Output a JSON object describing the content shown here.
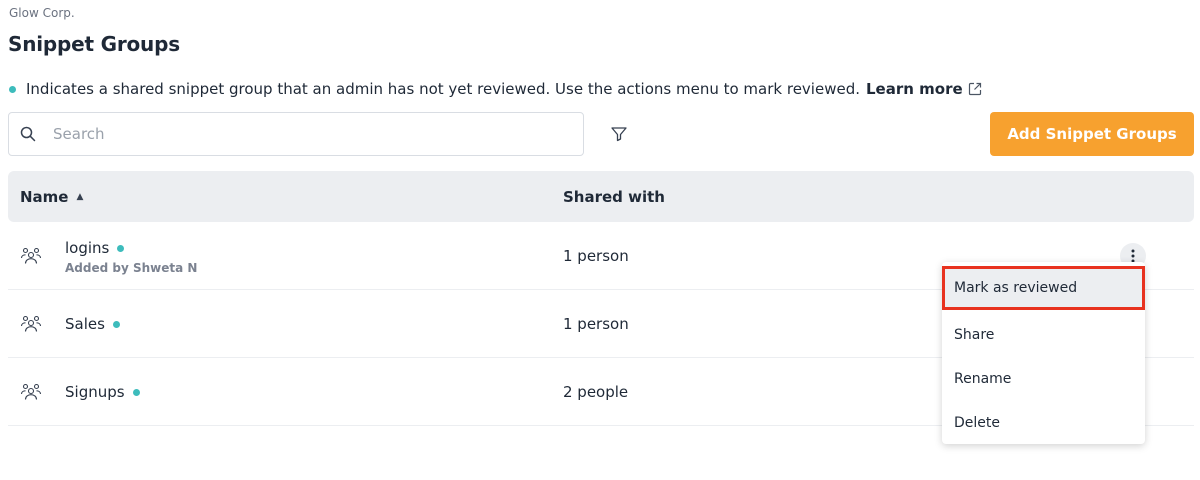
{
  "header": {
    "org_name": "Glow Corp.",
    "page_title": "Snippet Groups"
  },
  "notice": {
    "text": "Indicates a shared snippet group that an admin has not yet reviewed. Use the actions menu to mark reviewed.",
    "link_label": "Learn more",
    "dot_color": "#3dbcbc"
  },
  "search": {
    "placeholder": "Search",
    "value": ""
  },
  "toolbar": {
    "add_label": "Add Snippet Groups",
    "add_color": "#f7a12f"
  },
  "table": {
    "columns": {
      "name": "Name",
      "shared_with": "Shared with"
    },
    "sort": "ascending",
    "rows": [
      {
        "name": "logins",
        "added_by": "Added by Shweta N",
        "shared_with": "1 person",
        "unreviewed": true
      },
      {
        "name": "Sales",
        "added_by": "",
        "shared_with": "1 person",
        "unreviewed": true
      },
      {
        "name": "Signups",
        "added_by": "",
        "shared_with": "2 people",
        "unreviewed": true
      }
    ]
  },
  "actions_menu": {
    "items": [
      "Mark as reviewed",
      "Share",
      "Rename",
      "Delete"
    ],
    "highlighted": "Mark as reviewed",
    "highlight_color": "#e8321f"
  },
  "icons": {
    "search": "search-icon",
    "filter": "filter-icon",
    "external_link": "external-link-icon",
    "group": "group-icon",
    "kebab": "more-vertical-icon",
    "sort": "sort-ascending-icon"
  }
}
